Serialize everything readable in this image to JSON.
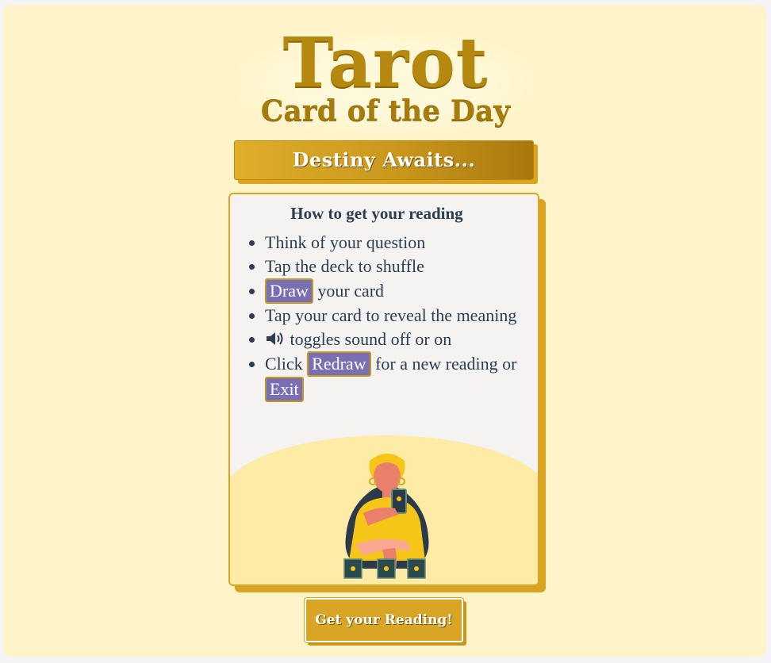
{
  "logo": {
    "title": "Tarot",
    "subtitle": "Card of the Day"
  },
  "banner": {
    "text": "Destiny Awaits..."
  },
  "instructions": {
    "title": "How to get your reading",
    "step1": "Think of your question",
    "step2": "Tap the deck to shuffle",
    "step3_button": "Draw",
    "step3_rest": " your card",
    "step4": "Tap your card to reveal the meaning",
    "step5_icon": "speaker-icon",
    "step5_rest": " toggles sound off or on",
    "step6_pre": "Click ",
    "step6_button": "Redraw",
    "step6_mid": " for a new reading or ",
    "step6_button2": "Exit"
  },
  "cta": {
    "label": "Get your Reading!"
  },
  "colors": {
    "page_background": "#fff4c9",
    "gold": "#d9a521",
    "chip_purple": "#7b6fb4",
    "text_dark": "#2c3e50",
    "hill": "#fdeba6"
  }
}
